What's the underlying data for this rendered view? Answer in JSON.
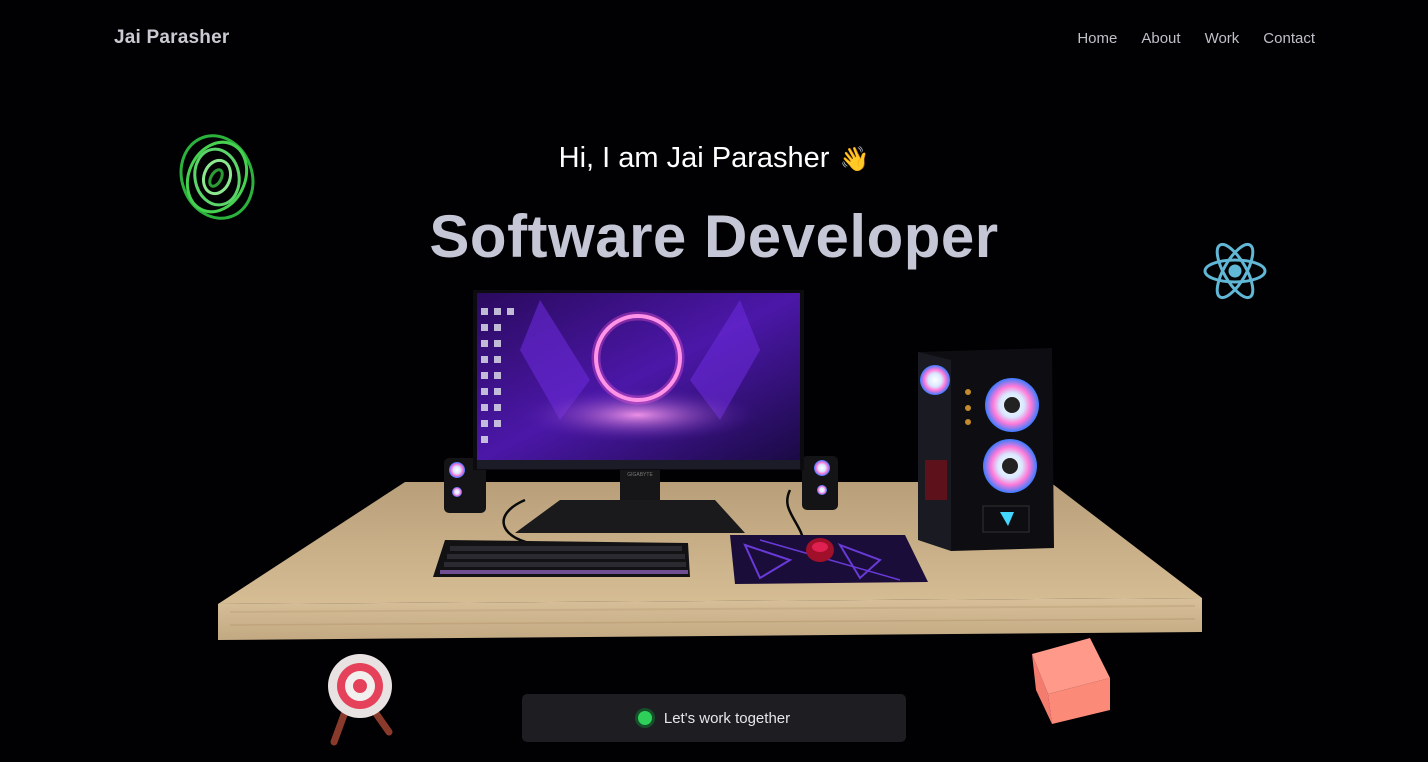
{
  "brand": {
    "name": "Jai Parasher"
  },
  "nav": {
    "items": [
      {
        "label": "Home"
      },
      {
        "label": "About"
      },
      {
        "label": "Work"
      },
      {
        "label": "Contact"
      }
    ]
  },
  "hero": {
    "greeting": "Hi, I am Jai Parasher",
    "wave_emoji": "👋",
    "title": "Software Developer"
  },
  "cta": {
    "label": "Let's work together",
    "status_color": "#2fd05a"
  },
  "scene": {
    "monitor_brand": "GIGABYTE",
    "floating_icons": [
      "spiral-ring-icon",
      "react-atom-icon",
      "target-icon",
      "cube-icon"
    ]
  },
  "colors": {
    "background": "#010103",
    "title": "#c6c7d6",
    "accent_green": "#2fd05a",
    "react_blue": "#61b7d6"
  }
}
